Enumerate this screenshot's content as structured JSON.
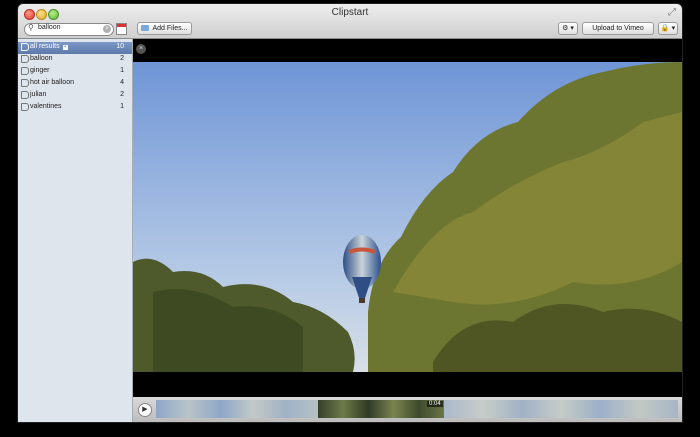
{
  "window": {
    "title": "Clipstart"
  },
  "search": {
    "value": "balloon"
  },
  "toolbar": {
    "add_files": "Add Files...",
    "gear": "⚙ ▾",
    "upload": "Upload to Vimeo",
    "lock": "🔒 ▾"
  },
  "sidebar": {
    "items": [
      {
        "label": "all results",
        "count": "10",
        "selected": true
      },
      {
        "label": "balloon",
        "count": "2"
      },
      {
        "label": "ginger",
        "count": "1"
      },
      {
        "label": "hot air balloon",
        "count": "4"
      },
      {
        "label": "julian",
        "count": "2"
      },
      {
        "label": "valentines",
        "count": "1"
      }
    ]
  },
  "player": {
    "current_time": "0:04"
  },
  "colors": {
    "selection": "#6b87b8",
    "sidebar_bg": "#dfe5ed",
    "sky": "#8fb0e4",
    "foliage": "#6f7a2a"
  }
}
